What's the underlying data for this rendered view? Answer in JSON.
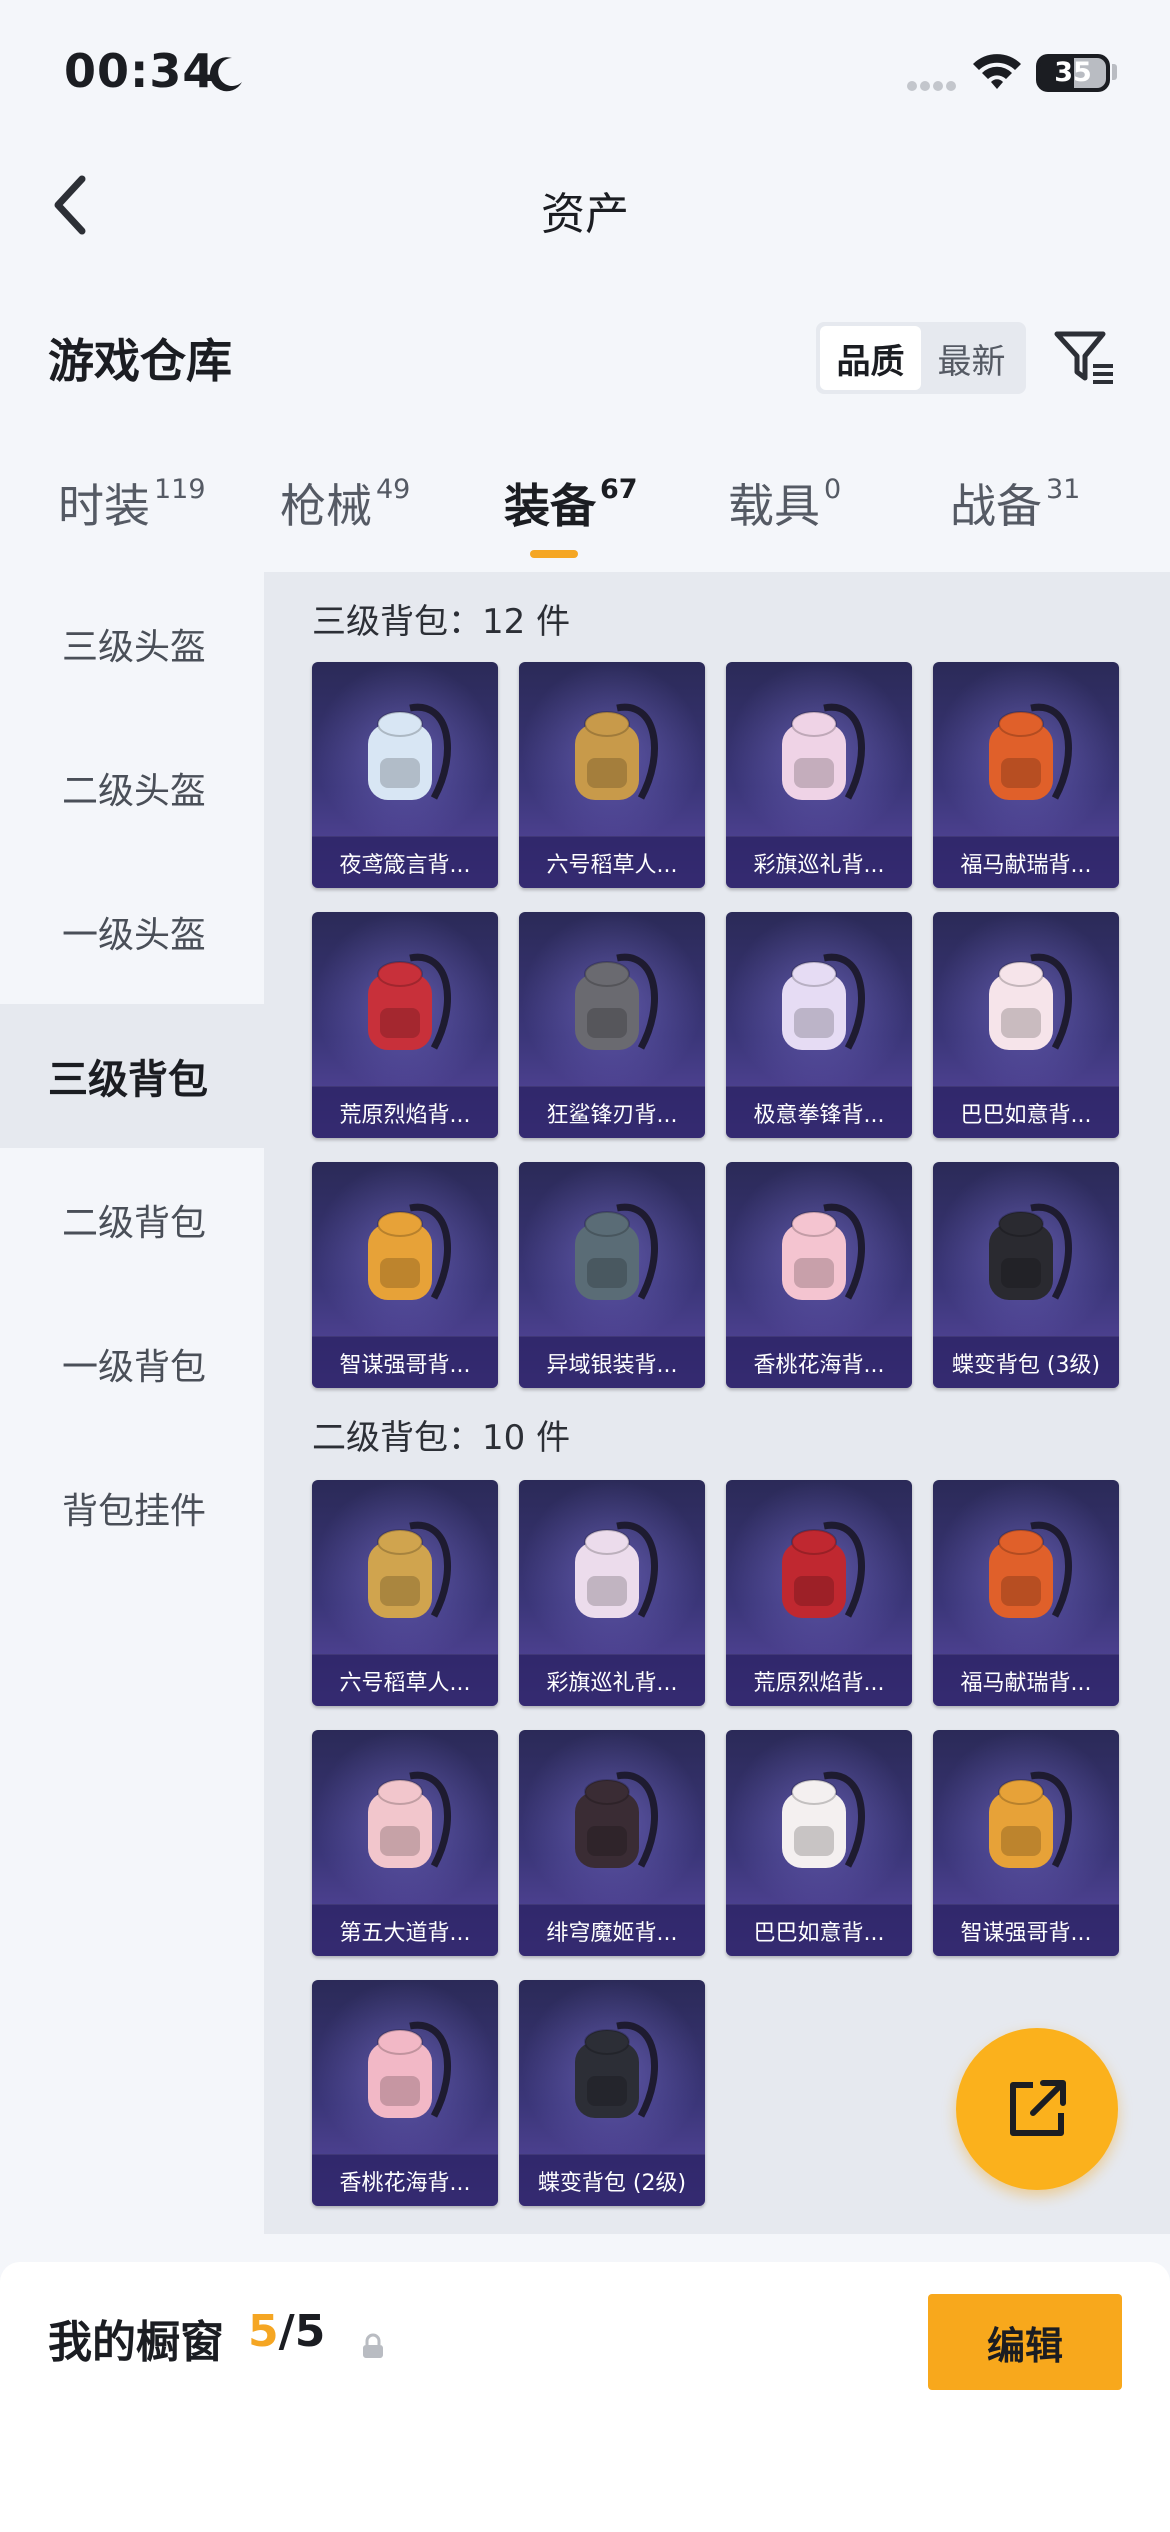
{
  "status_bar": {
    "time": "00:34",
    "battery": "35"
  },
  "nav": {
    "title": "资产"
  },
  "header": {
    "title": "游戏仓库",
    "sort_options": [
      "品质",
      "最新"
    ],
    "active_sort": "品质"
  },
  "tabs": [
    {
      "label": "时装",
      "count": "119"
    },
    {
      "label": "枪械",
      "count": "49"
    },
    {
      "label": "装备",
      "count": "67"
    },
    {
      "label": "载具",
      "count": "0"
    },
    {
      "label": "战备",
      "count": "31"
    }
  ],
  "active_tab": "装备",
  "sidebar": {
    "items": [
      "三级头盔",
      "二级头盔",
      "一级头盔",
      "三级背包",
      "二级背包",
      "一级背包",
      "背包挂件"
    ],
    "active": "三级背包"
  },
  "sections": [
    {
      "title": "三级背包：12 件",
      "items": [
        {
          "label": "夜鸢箴言背...",
          "color": "#d8e6f4"
        },
        {
          "label": "六号稻草人...",
          "color": "#c89a4a"
        },
        {
          "label": "彩旗巡礼背...",
          "color": "#efd3e6"
        },
        {
          "label": "福马献瑞背...",
          "color": "#e0602a"
        },
        {
          "label": "荒原烈焰背...",
          "color": "#c8303a"
        },
        {
          "label": "狂鲨锋刃背...",
          "color": "#6a6a70"
        },
        {
          "label": "极意拳锋背...",
          "color": "#e6dcf4"
        },
        {
          "label": "巴巴如意背...",
          "color": "#f6e4ea"
        },
        {
          "label": "智谋强哥背...",
          "color": "#e7a238"
        },
        {
          "label": "异域银装背...",
          "color": "#5a6c76"
        },
        {
          "label": "香桃花海背...",
          "color": "#f4c4d0"
        },
        {
          "label": "蝶变背包 (3级)",
          "color": "#2a2a30"
        }
      ]
    },
    {
      "title": "二级背包：10 件",
      "items": [
        {
          "label": "六号稻草人...",
          "color": "#d0a44e"
        },
        {
          "label": "彩旗巡礼背...",
          "color": "#ecdcec"
        },
        {
          "label": "荒原烈焰背...",
          "color": "#c02830"
        },
        {
          "label": "福马献瑞背...",
          "color": "#e0602a"
        },
        {
          "label": "第五大道背...",
          "color": "#f2c6cc"
        },
        {
          "label": "绯穹魔姬背...",
          "color": "#3a2c34"
        },
        {
          "label": "巴巴如意背...",
          "color": "#f4f0f0"
        },
        {
          "label": "智谋强哥背...",
          "color": "#e7a238"
        },
        {
          "label": "香桃花海背...",
          "color": "#f2b8c6"
        },
        {
          "label": "蝶变背包 (2级)",
          "color": "#2c2e36"
        }
      ]
    }
  ],
  "bottom": {
    "label": "我的橱窗",
    "current": "5",
    "total": "5",
    "edit_label": "编辑"
  },
  "colors": {
    "accent": "#f5a623",
    "card_bg": "#3b3679",
    "panel_bg": "#e6e9ef"
  }
}
